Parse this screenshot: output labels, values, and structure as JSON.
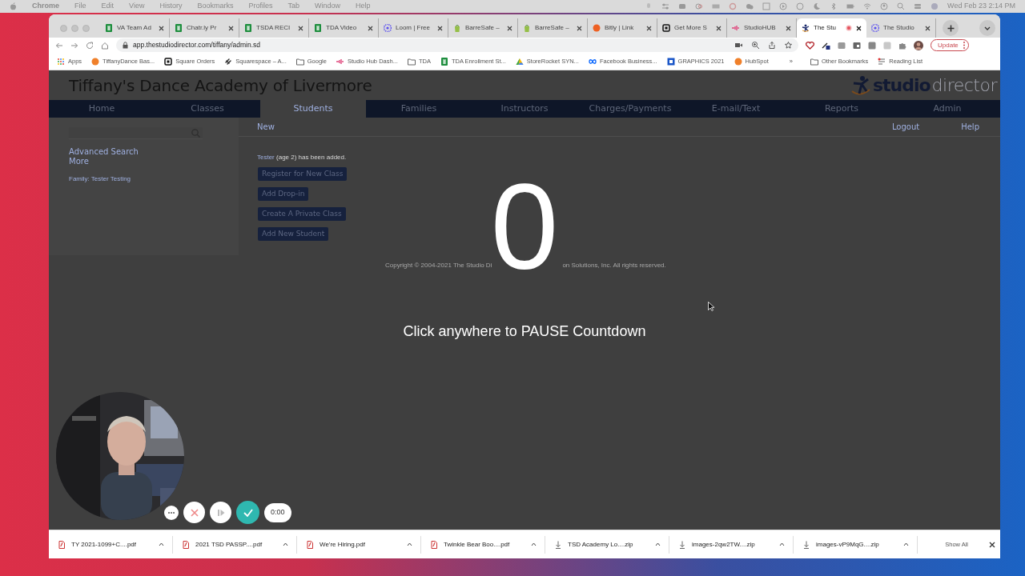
{
  "menu_bar": {
    "app": "Chrome",
    "items": [
      "File",
      "Edit",
      "View",
      "History",
      "Bookmarks",
      "Profiles",
      "Tab",
      "Window",
      "Help"
    ],
    "clock": "Wed Feb 23  2:14 PM"
  },
  "browser": {
    "tabs": [
      {
        "title": "VA Team Ad",
        "kind": "sheets",
        "selected": false
      },
      {
        "title": "Chatr.ly Pr",
        "kind": "sheets",
        "selected": false
      },
      {
        "title": "TSDA RECI",
        "kind": "sheets",
        "selected": false
      },
      {
        "title": "TDA Video",
        "kind": "sheets",
        "selected": false
      },
      {
        "title": "Loom | Free",
        "kind": "loom",
        "selected": false
      },
      {
        "title": "BarreSafe –",
        "kind": "shop",
        "selected": false
      },
      {
        "title": "BarreSafe –",
        "kind": "shop",
        "selected": false
      },
      {
        "title": "Bitly | Link",
        "kind": "bitly",
        "selected": false
      },
      {
        "title": "Get More S",
        "kind": "square",
        "selected": false
      },
      {
        "title": "StudioHUB",
        "kind": "hub",
        "selected": false
      },
      {
        "title": "The Stu",
        "kind": "studio",
        "selected": true
      },
      {
        "title": "The Studio",
        "kind": "loom",
        "selected": false
      }
    ],
    "address": "app.thestudiodirector.com/tiffany/admin.sd",
    "update_button": "Update",
    "bookmarks": [
      {
        "label": "Apps",
        "kind": "apps"
      },
      {
        "label": "TiffanyDance Bas...",
        "kind": "orange"
      },
      {
        "label": "Square Orders",
        "kind": "square"
      },
      {
        "label": "Squarespace – A...",
        "kind": "swirl"
      },
      {
        "label": "Google",
        "kind": "folder"
      },
      {
        "label": "Studio Hub Dash...",
        "kind": "hub"
      },
      {
        "label": "TDA",
        "kind": "folder"
      },
      {
        "label": "TDA Enrollment St...",
        "kind": "sheets"
      },
      {
        "label": "StoreRocket SYN...",
        "kind": "drive"
      },
      {
        "label": "Facebook Business...",
        "kind": "meta"
      },
      {
        "label": "GRAPHICS 2021",
        "kind": "blue"
      },
      {
        "label": "HubSpot",
        "kind": "orange"
      }
    ],
    "more_bookmarks": "»",
    "other_bookmarks": "Other Bookmarks",
    "reading_list": "Reading List"
  },
  "app": {
    "title": "Tiffany's Dance Academy of Livermore",
    "logo": {
      "bold": "studio",
      "light": "director"
    },
    "nav": [
      {
        "label": "Home",
        "selected": false
      },
      {
        "label": "Classes",
        "selected": false
      },
      {
        "label": "Students",
        "selected": true
      },
      {
        "label": "Families",
        "selected": false
      },
      {
        "label": "Instructors",
        "selected": false
      },
      {
        "label": "Charges/Payments",
        "selected": false
      },
      {
        "label": "E-mail/Text",
        "selected": false
      },
      {
        "label": "Reports",
        "selected": false
      },
      {
        "label": "Admin",
        "selected": false
      }
    ],
    "sidebar": {
      "links": [
        "Advanced Search",
        "More"
      ],
      "family": "Family: Tester Testing"
    },
    "subnav": {
      "new": "New",
      "logout": "Logout",
      "help": "Help"
    },
    "message": {
      "link": "Tester",
      "text": " (age 2) has been added."
    },
    "actions": [
      "Register for New Class",
      "Add Drop-in",
      "Create A Private Class",
      "Add New Student"
    ],
    "copyright": [
      "Copyright © 2004-2021 The Studio Di",
      "on Solutions, Inc. All rights reserved."
    ]
  },
  "overlay": {
    "countdown": "0",
    "hint": "Click anywhere to PAUSE Countdown"
  },
  "recorder": {
    "timer": "0:00"
  },
  "downloads": {
    "items": [
      {
        "name": "TY 2021-1099+C....pdf",
        "kind": "pdf"
      },
      {
        "name": "2021 TSD PASSP....pdf",
        "kind": "pdf"
      },
      {
        "name": "We're Hiring.pdf",
        "kind": "pdf"
      },
      {
        "name": "Twinkle Bear Boo....pdf",
        "kind": "pdf"
      },
      {
        "name": "TSD Academy Lo....zip",
        "kind": "zip"
      },
      {
        "name": "images-2qw2TW....zip",
        "kind": "zip"
      },
      {
        "name": "images-vP9MqG....zip",
        "kind": "zip"
      }
    ],
    "show_all": "Show All"
  }
}
